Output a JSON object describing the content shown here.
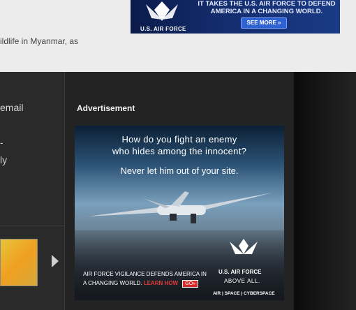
{
  "article": {
    "snippet": "ildlife in Myanmar, as"
  },
  "top_banner": {
    "headline": "IT TAKES THE U.S. AIR FORCE TO DEFEND AMERICA IN A CHANGING WORLD.",
    "see_more": "SEE MORE »",
    "brand": "U.S. AIR FORCE"
  },
  "sidebar": {
    "email": "email",
    "dash": "-",
    "ly": "ly"
  },
  "ad": {
    "label": "Advertisement",
    "question_line1": "How do you fight an enemy",
    "question_line2": "who hides among the innocent?",
    "answer": "Never let him out of your site.",
    "mission_line1": "AIR FORCE VIGILANCE DEFENDS AMERICA IN",
    "mission_line2": "A CHANGING WORLD.",
    "learn_how": "LEARN HOW",
    "go": "GO»",
    "brand": "U.S. AIR FORCE",
    "tagline": "ABOVE ALL.",
    "domains": "AIR | SPACE | CYBERSPACE"
  }
}
